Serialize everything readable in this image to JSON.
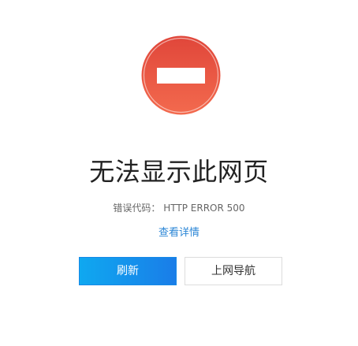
{
  "error": {
    "title": "无法显示此网页",
    "code_label": "错误代码：",
    "code_value": "HTTP ERROR 500",
    "details_link": "查看详情"
  },
  "buttons": {
    "refresh_label": "刷新",
    "navigate_label": "上网导航"
  },
  "icons": {
    "status": "stop-icon"
  },
  "colors": {
    "icon_top": "#e24a3a",
    "icon_bottom": "#f2684d",
    "link": "#2b86d6",
    "primary_start": "#0fa8f0",
    "primary_end": "#1a7de8"
  }
}
